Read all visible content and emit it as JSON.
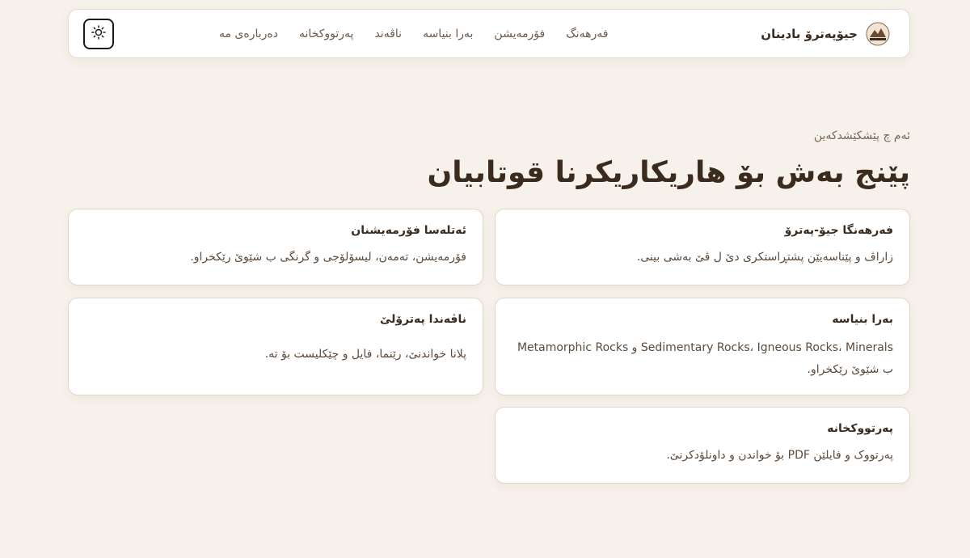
{
  "brand": {
    "name": "جیۆپەترۆ بادینان",
    "logo_icon": "geopetro-logo-icon"
  },
  "nav": {
    "links": [
      {
        "label": "فەرهەنگ"
      },
      {
        "label": "فۆرمەیشن"
      },
      {
        "label": "بەرا بنیاسە"
      },
      {
        "label": "ناڤەند"
      },
      {
        "label": "پەرتووکخانە"
      },
      {
        "label": "دەربارەی مە"
      }
    ],
    "theme_toggle_icon": "sun-icon"
  },
  "hero": {
    "eyebrow": "ئەم چ پێشکێشدکەین",
    "title": "پێنج بەش بۆ هاریکاریکرنا قوتابیان"
  },
  "cards": [
    {
      "title": "فەرهەنگا جیۆ-پەترۆ",
      "desc": "زاراڤ و پێناسەیێن پشتڕاستکری دێ ل ڤێ بەشی بینی."
    },
    {
      "title": "ئەتلەسا فۆرمەیشنان",
      "desc": "فۆرمەیشن، تەمەن، لیسۆلۆجی و گرنگی ب شێوێ رێکخراو."
    },
    {
      "title": "بەرا بنیاسە",
      "desc": "Sedimentary Rocks، Igneous Rocks، Minerals و Metamorphic Rocks ب شێوێ رێکخراو."
    },
    {
      "title": "ناڤەندا پەترۆلێ",
      "desc": "پلانا خواندنێ، رێنما، فایل و چێکلیست بۆ تە."
    },
    {
      "title": "پەرتووکخانە",
      "desc": "پەرتووک و فایلێن PDF بۆ خواندن و داونلۆدکرنێ."
    }
  ],
  "colors": {
    "background": "#f6f1ea",
    "card": "#ffffff",
    "text": "#3b2b1f",
    "muted": "#6b5a4b"
  }
}
